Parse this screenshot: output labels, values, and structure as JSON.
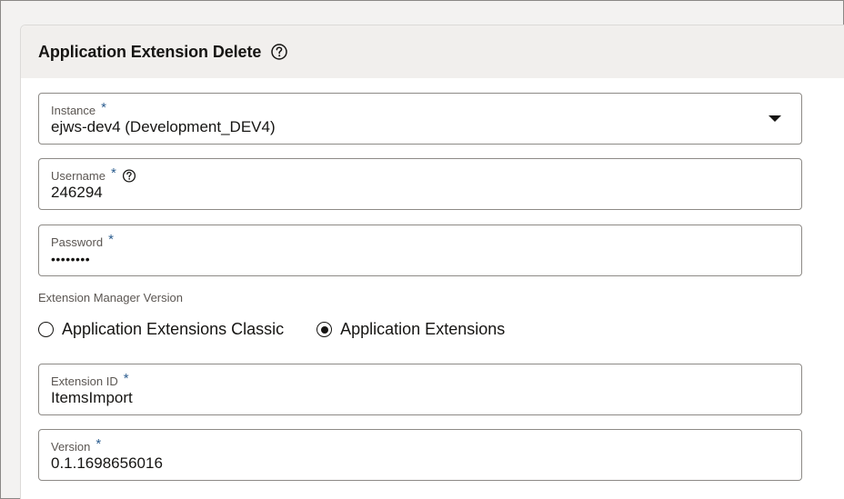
{
  "panel": {
    "title": "Application Extension Delete",
    "help_icon": "question-circle-icon"
  },
  "fields": {
    "instance": {
      "label": "Instance",
      "required": "*",
      "value": "ejws-dev4 (Development_DEV4)",
      "icon": "caret-down-icon"
    },
    "username": {
      "label": "Username",
      "required": "*",
      "value": "246294",
      "help_icon": "question-circle-icon"
    },
    "password": {
      "label": "Password",
      "required": "*",
      "value": "••••••••"
    },
    "extension_id": {
      "label": "Extension ID",
      "required": "*",
      "value": "ItemsImport"
    },
    "version": {
      "label": "Version",
      "required": "*",
      "value": "0.1.1698656016"
    }
  },
  "extension_manager": {
    "label": "Extension Manager Version",
    "options": [
      {
        "label": "Application Extensions Classic",
        "selected": false
      },
      {
        "label": "Application Extensions",
        "selected": true
      }
    ]
  },
  "colors": {
    "header_bg": "#f1efed",
    "required_star": "#2c5d8f",
    "border": "#8d8a86",
    "text": "#161513",
    "label": "#5b5652"
  }
}
